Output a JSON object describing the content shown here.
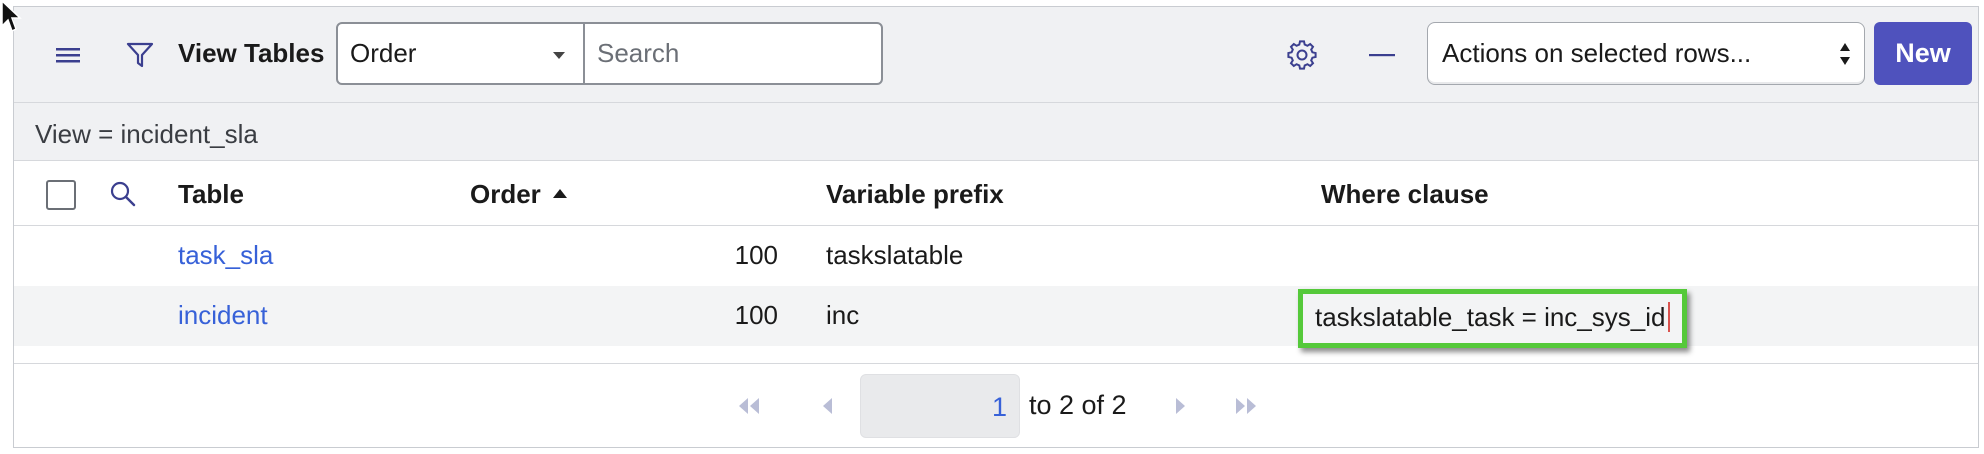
{
  "header": {
    "title": "View Tables",
    "order_select_value": "Order",
    "search_placeholder": "Search",
    "actions_select_value": "Actions on selected rows...",
    "new_label": "New"
  },
  "view": {
    "label": "View = incident_sla"
  },
  "table": {
    "columns": {
      "table": "Table",
      "order": "Order",
      "prefix": "Variable prefix",
      "where": "Where clause"
    },
    "sort": {
      "column": "Order",
      "direction": "ascending"
    },
    "rows": [
      {
        "table": "task_sla",
        "order": "100",
        "prefix": "taskslatable",
        "where": ""
      },
      {
        "table": "incident",
        "order": "100",
        "prefix": "inc",
        "where": "taskslatable_task = inc_sys_id"
      }
    ]
  },
  "pagination": {
    "current_page": "1",
    "range_text": "to 2 of 2"
  },
  "colors": {
    "accent": "#4f52bd",
    "link": "#3761d8",
    "highlight_border": "#55c93a",
    "header_bg": "#f0f1f3"
  },
  "icons": [
    "mouse-cursor-icon",
    "hamburger-menu-icon",
    "filter-icon",
    "gear-icon",
    "minus-icon",
    "updown-caret-icon",
    "search-icon",
    "sort-ascending-icon",
    "first-page-icon",
    "previous-page-icon",
    "next-page-icon",
    "last-page-icon"
  ]
}
